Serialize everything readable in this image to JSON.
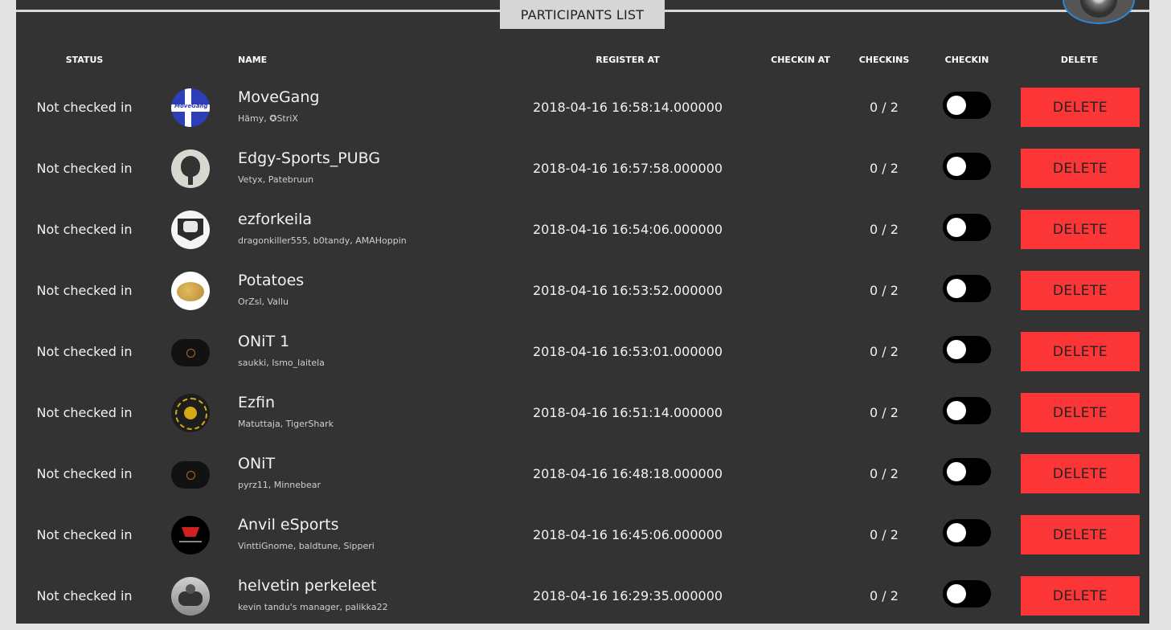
{
  "title": "PARTICIPANTS LIST",
  "columns": {
    "status": "STATUS",
    "name": "NAME",
    "register_at": "REGISTER AT",
    "checkin_at": "CHECKIN AT",
    "checkins": "CHECKINS",
    "checkin": "CHECKIN",
    "delete": "DELETE"
  },
  "rows": [
    {
      "status": "Not checked in",
      "name": "MoveGang",
      "members": "Hämy, ✪StriX",
      "register_at": "2018-04-16 16:58:14.000000",
      "checkin_at": "",
      "checkins": "0 / 2",
      "checked_in": false,
      "delete_label": "DELETE",
      "avatar": "movegang",
      "avatar_text": "MoveGang"
    },
    {
      "status": "Not checked in",
      "name": "Edgy-Sports_PUBG",
      "members": "Vetyx, Patebruun",
      "register_at": "2018-04-16 16:57:58.000000",
      "checkin_at": "",
      "checkins": "0 / 2",
      "checked_in": false,
      "delete_label": "DELETE",
      "avatar": "edgy"
    },
    {
      "status": "Not checked in",
      "name": "ezforkeila",
      "members": "dragonkiller555, b0tandy, AMAHoppin",
      "register_at": "2018-04-16 16:54:06.000000",
      "checkin_at": "",
      "checkins": "0 / 2",
      "checked_in": false,
      "delete_label": "DELETE",
      "avatar": "ez"
    },
    {
      "status": "Not checked in",
      "name": "Potatoes",
      "members": "OrZsl, Vallu",
      "register_at": "2018-04-16 16:53:52.000000",
      "checkin_at": "",
      "checkins": "0 / 2",
      "checked_in": false,
      "delete_label": "DELETE",
      "avatar": "potato"
    },
    {
      "status": "Not checked in",
      "name": "ONiT 1",
      "members": "saukki, Ismo_laitela",
      "register_at": "2018-04-16 16:53:01.000000",
      "checkin_at": "",
      "checkins": "0 / 2",
      "checked_in": false,
      "delete_label": "DELETE",
      "avatar": "onit"
    },
    {
      "status": "Not checked in",
      "name": "Ezfin",
      "members": "Matuttaja, TigerShark",
      "register_at": "2018-04-16 16:51:14.000000",
      "checkin_at": "",
      "checkins": "0 / 2",
      "checked_in": false,
      "delete_label": "DELETE",
      "avatar": "ezfin"
    },
    {
      "status": "Not checked in",
      "name": "ONiT",
      "members": "pyrz11, Minnebear",
      "register_at": "2018-04-16 16:48:18.000000",
      "checkin_at": "",
      "checkins": "0 / 2",
      "checked_in": false,
      "delete_label": "DELETE",
      "avatar": "onit"
    },
    {
      "status": "Not checked in",
      "name": "Anvil eSports",
      "members": "VinttiGnome, baldtune, Sipperi",
      "register_at": "2018-04-16 16:45:06.000000",
      "checkin_at": "",
      "checkins": "0 / 2",
      "checked_in": false,
      "delete_label": "DELETE",
      "avatar": "anvil"
    },
    {
      "status": "Not checked in",
      "name": "helvetin perkeleet",
      "members": "kevin tandu's manager, palikka22",
      "register_at": "2018-04-16 16:29:35.000000",
      "checkin_at": "",
      "checkins": "0 / 2",
      "checked_in": false,
      "delete_label": "DELETE",
      "avatar": "helvetin"
    }
  ],
  "colors": {
    "panel_bg": "#333333",
    "page_bg": "#e3e3e3",
    "delete_button": "#fc3636",
    "toggle_off": "#000000",
    "title_tab_bg": "#d6d6d6",
    "avatar_ring": "#2b87d4"
  }
}
